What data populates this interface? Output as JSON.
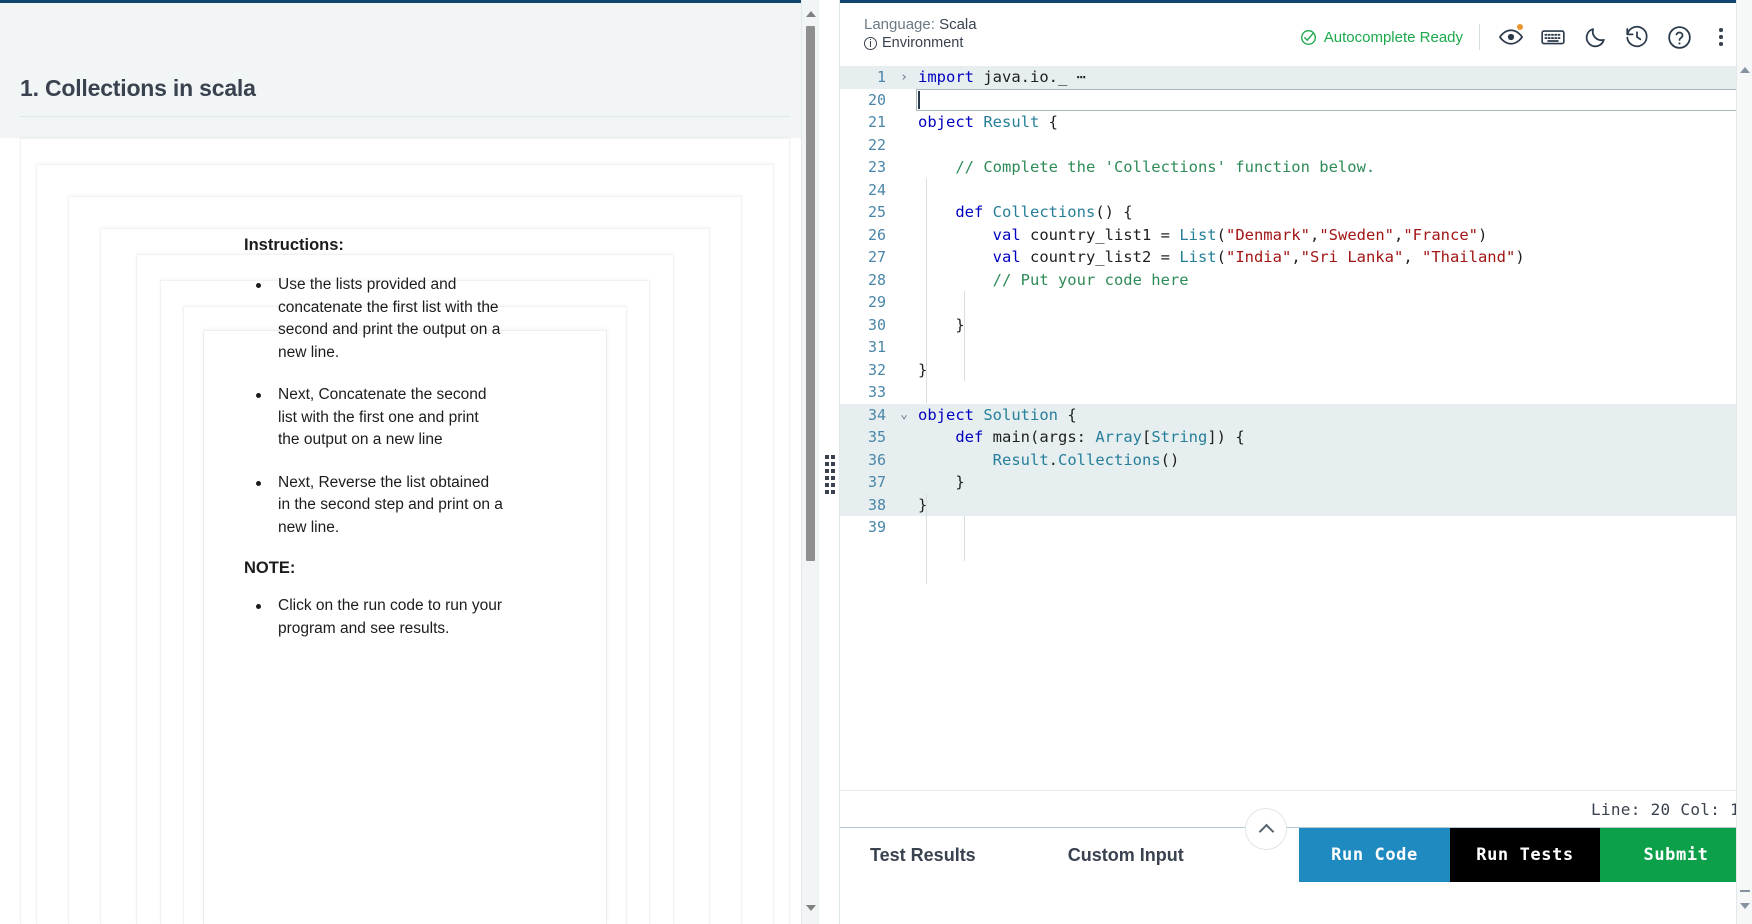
{
  "left": {
    "problem_title": "1. Collections in scala",
    "instructions_heading": "Instructions:",
    "instructions": [
      "Use the lists provided and concatenate the first list with the second and print the output on a new line.",
      "Next, Concatenate the second list with the first one and print the output on a new line",
      "Next, Reverse the list obtained in the second step and print on a new line."
    ],
    "note_heading": "NOTE:",
    "notes": [
      "Click on the run code to run your program and see results."
    ]
  },
  "editor": {
    "language_label": "Language:",
    "language_value": "Scala",
    "environment_label": "Environment",
    "autocomplete_status": "Autocomplete Ready",
    "icons": {
      "eye": "eye-icon",
      "keyboard": "keyboard-icon",
      "moon": "dark-mode-icon",
      "history": "history-icon",
      "help": "help-icon",
      "more": "more-options-icon"
    },
    "status_line": "Line: 20 Col: 1",
    "lines": [
      {
        "num": "1",
        "fold": "›",
        "highlight": true,
        "indent": 0,
        "tokens": [
          {
            "t": "import ",
            "c": "tk-kw"
          },
          {
            "t": "java",
            "c": "tk-plain"
          },
          {
            "t": ".",
            "c": "tk-plain"
          },
          {
            "t": "io",
            "c": "tk-plain"
          },
          {
            "t": "._",
            "c": "tk-plain"
          },
          {
            "t": " ⋯",
            "c": "tk-plain"
          }
        ]
      },
      {
        "num": "20",
        "fold": "",
        "highlight": false,
        "indent": 0,
        "tokens": []
      },
      {
        "num": "21",
        "fold": "",
        "highlight": false,
        "indent": 0,
        "tokens": [
          {
            "t": "object ",
            "c": "tk-kw"
          },
          {
            "t": "Result",
            "c": "tk-type"
          },
          {
            "t": " {",
            "c": "tk-plain"
          }
        ]
      },
      {
        "num": "22",
        "fold": "",
        "highlight": false,
        "indent": 1,
        "tokens": []
      },
      {
        "num": "23",
        "fold": "",
        "highlight": false,
        "indent": 1,
        "tokens": [
          {
            "t": "    // Complete the 'Collections' function below.",
            "c": "tk-cmt"
          }
        ]
      },
      {
        "num": "24",
        "fold": "",
        "highlight": false,
        "indent": 1,
        "tokens": []
      },
      {
        "num": "25",
        "fold": "",
        "highlight": false,
        "indent": 1,
        "tokens": [
          {
            "t": "    ",
            "c": "tk-plain"
          },
          {
            "t": "def ",
            "c": "tk-kw"
          },
          {
            "t": "Collections",
            "c": "tk-fn"
          },
          {
            "t": "() {",
            "c": "tk-plain"
          }
        ]
      },
      {
        "num": "26",
        "fold": "",
        "highlight": false,
        "indent": 2,
        "tokens": [
          {
            "t": "        ",
            "c": "tk-plain"
          },
          {
            "t": "val ",
            "c": "tk-kw"
          },
          {
            "t": "country_list1",
            "c": "tk-plain"
          },
          {
            "t": " = ",
            "c": "tk-plain"
          },
          {
            "t": "List",
            "c": "tk-type"
          },
          {
            "t": "(",
            "c": "tk-plain"
          },
          {
            "t": "\"Denmark\"",
            "c": "tk-str"
          },
          {
            "t": ",",
            "c": "tk-plain"
          },
          {
            "t": "\"Sweden\"",
            "c": "tk-str"
          },
          {
            "t": ",",
            "c": "tk-plain"
          },
          {
            "t": "\"France\"",
            "c": "tk-str"
          },
          {
            "t": ")",
            "c": "tk-plain"
          }
        ]
      },
      {
        "num": "27",
        "fold": "",
        "highlight": false,
        "indent": 2,
        "tokens": [
          {
            "t": "        ",
            "c": "tk-plain"
          },
          {
            "t": "val ",
            "c": "tk-kw"
          },
          {
            "t": "country_list2",
            "c": "tk-plain"
          },
          {
            "t": " = ",
            "c": "tk-plain"
          },
          {
            "t": "List",
            "c": "tk-type"
          },
          {
            "t": "(",
            "c": "tk-plain"
          },
          {
            "t": "\"India\"",
            "c": "tk-str"
          },
          {
            "t": ",",
            "c": "tk-plain"
          },
          {
            "t": "\"Sri Lanka\"",
            "c": "tk-str"
          },
          {
            "t": ", ",
            "c": "tk-plain"
          },
          {
            "t": "\"Thailand\"",
            "c": "tk-str"
          },
          {
            "t": ")",
            "c": "tk-plain"
          }
        ]
      },
      {
        "num": "28",
        "fold": "",
        "highlight": false,
        "indent": 2,
        "tokens": [
          {
            "t": "        // Put your code here",
            "c": "tk-cmt"
          }
        ]
      },
      {
        "num": "29",
        "fold": "",
        "highlight": false,
        "indent": 2,
        "tokens": []
      },
      {
        "num": "30",
        "fold": "",
        "highlight": false,
        "indent": 1,
        "tokens": [
          {
            "t": "    }",
            "c": "tk-plain"
          }
        ]
      },
      {
        "num": "31",
        "fold": "",
        "highlight": false,
        "indent": 1,
        "tokens": []
      },
      {
        "num": "32",
        "fold": "",
        "highlight": false,
        "indent": 0,
        "tokens": [
          {
            "t": "}",
            "c": "tk-plain"
          }
        ]
      },
      {
        "num": "33",
        "fold": "",
        "highlight": false,
        "indent": 0,
        "tokens": []
      },
      {
        "num": "34",
        "fold": "⌄",
        "highlight": true,
        "indent": 0,
        "tokens": [
          {
            "t": "object ",
            "c": "tk-kw"
          },
          {
            "t": "Solution",
            "c": "tk-type"
          },
          {
            "t": " {",
            "c": "tk-plain"
          }
        ]
      },
      {
        "num": "35",
        "fold": "",
        "highlight": true,
        "indent": 1,
        "tokens": [
          {
            "t": "    ",
            "c": "tk-plain"
          },
          {
            "t": "def ",
            "c": "tk-kw"
          },
          {
            "t": "main",
            "c": "tk-plain"
          },
          {
            "t": "(",
            "c": "tk-plain"
          },
          {
            "t": "args",
            "c": "tk-plain"
          },
          {
            "t": ": ",
            "c": "tk-plain"
          },
          {
            "t": "Array",
            "c": "tk-type"
          },
          {
            "t": "[",
            "c": "tk-plain"
          },
          {
            "t": "String",
            "c": "tk-type"
          },
          {
            "t": "]) {",
            "c": "tk-plain"
          }
        ]
      },
      {
        "num": "36",
        "fold": "",
        "highlight": true,
        "indent": 2,
        "tokens": [
          {
            "t": "        ",
            "c": "tk-plain"
          },
          {
            "t": "Result",
            "c": "tk-type"
          },
          {
            "t": ".",
            "c": "tk-plain"
          },
          {
            "t": "Collections",
            "c": "tk-fn"
          },
          {
            "t": "()",
            "c": "tk-plain"
          }
        ]
      },
      {
        "num": "37",
        "fold": "",
        "highlight": true,
        "indent": 1,
        "tokens": [
          {
            "t": "    }",
            "c": "tk-plain"
          }
        ]
      },
      {
        "num": "38",
        "fold": "",
        "highlight": true,
        "indent": 0,
        "tokens": [
          {
            "t": "}",
            "c": "tk-plain"
          }
        ]
      },
      {
        "num": "39",
        "fold": "",
        "highlight": false,
        "indent": 0,
        "tokens": []
      }
    ]
  },
  "bottom": {
    "tabs": [
      "Test Results",
      "Custom Input"
    ],
    "run_code": "Run Code",
    "run_tests": "Run Tests",
    "submit": "Submit"
  },
  "colors": {
    "accent_blue": "#1f8ac0",
    "submit_green": "#0ca04a",
    "tests_black": "#000000",
    "header_navy": "#10466e",
    "success_green": "#1ba94c",
    "error_red": "#fa6a6a",
    "badge_orange": "#e8952f"
  }
}
